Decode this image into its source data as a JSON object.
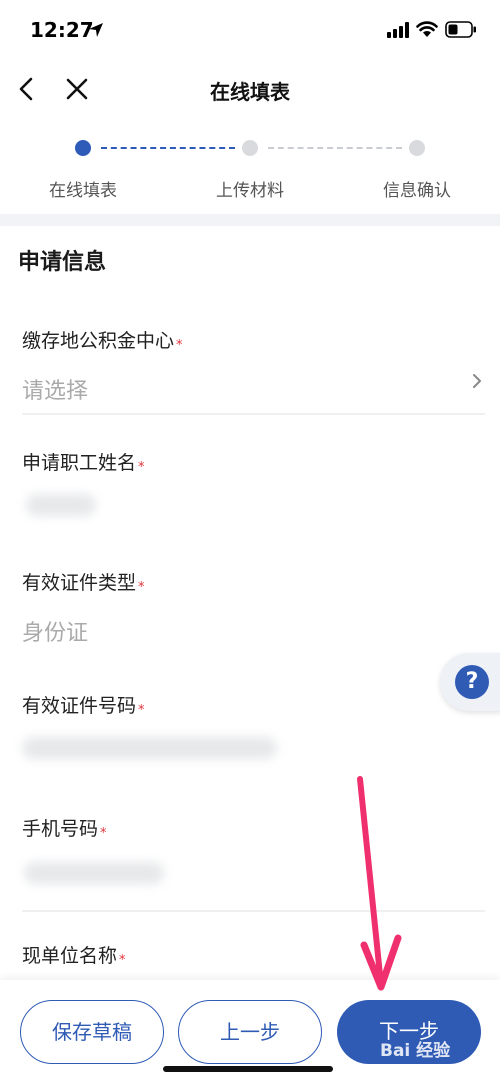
{
  "status_bar": {
    "time": "12:27"
  },
  "nav": {
    "title": "在线填表"
  },
  "steps": [
    {
      "label": "在线填表",
      "active": true
    },
    {
      "label": "上传材料",
      "active": false
    },
    {
      "label": "信息确认",
      "active": false
    }
  ],
  "form": {
    "section_title": "申请信息",
    "required_mark": "*",
    "fields": [
      {
        "label": "缴存地公积金中心",
        "value": "请选择"
      },
      {
        "label": "申请职工姓名",
        "value": ""
      },
      {
        "label": "有效证件类型",
        "value": "身份证"
      },
      {
        "label": "有效证件号码",
        "value": ""
      },
      {
        "label": "手机号码",
        "value": ""
      },
      {
        "label": "现单位名称",
        "value": ""
      }
    ]
  },
  "help": {
    "icon": "question-icon",
    "symbol": "?"
  },
  "bottom": {
    "save_draft": "保存草稿",
    "prev_step": "上一步",
    "next_step": "下一步"
  },
  "watermark": "Bai 经验",
  "colors": {
    "primary": "#2f5bb5",
    "required": "#e0333a",
    "annotation": "#f0306e"
  }
}
